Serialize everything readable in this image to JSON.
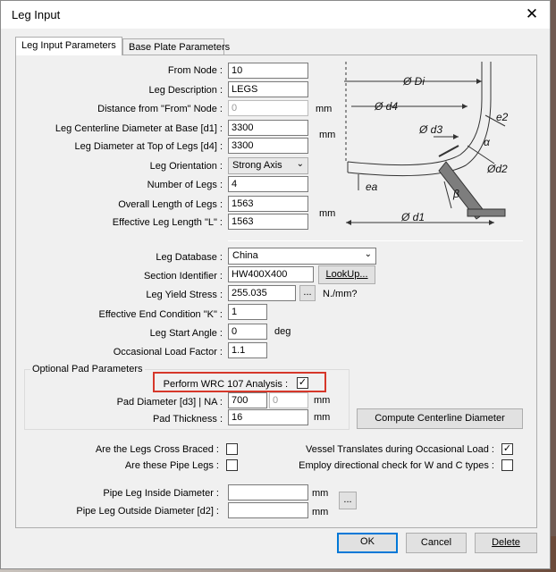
{
  "window": {
    "title": "Leg Input",
    "close_glyph": "✕"
  },
  "tabs": [
    "Leg Input Parameters",
    "Base Plate Parameters"
  ],
  "fields": {
    "from_node": {
      "label": "From Node :",
      "value": "10"
    },
    "leg_description": {
      "label": "Leg Description :",
      "value": "LEGS"
    },
    "distance_from": {
      "label": "Distance from \"From\" Node :",
      "value": "0",
      "unit": "mm"
    },
    "centerline_diameter": {
      "label": "Leg Centerline Diameter at Base [d1] :",
      "value": "3300"
    },
    "leg_diameter_top": {
      "label": "Leg Diameter at Top of Legs [d4] :",
      "value": "3300"
    },
    "diam_unit": "mm",
    "leg_orientation": {
      "label": "Leg Orientation :",
      "value": "Strong Axis"
    },
    "number_of_legs": {
      "label": "Number of Legs :",
      "value": "4"
    },
    "overall_length": {
      "label": "Overall Length of Legs :",
      "value": "1563"
    },
    "effective_length": {
      "label": "Effective Leg Length \"L\" :",
      "value": "1563"
    },
    "length_unit": "mm",
    "leg_database": {
      "label": "Leg Database :",
      "value": "China"
    },
    "section_identifier": {
      "label": "Section Identifier :",
      "value": "HW400X400"
    },
    "lookup_button": "LookUp...",
    "yield_stress": {
      "label": "Leg Yield Stress :",
      "value": "255.035",
      "unit": "N./mm?"
    },
    "end_condition": {
      "label": "Effective End Condition \"K\" :",
      "value": "1"
    },
    "start_angle": {
      "label": "Leg Start Angle :",
      "value": "0",
      "unit": "deg"
    },
    "load_factor": {
      "label": "Occasional Load Factor :",
      "value": "1.1"
    }
  },
  "pad": {
    "group_title": "Optional Pad Parameters",
    "wrc_label": "Perform WRC 107 Analysis :",
    "wrc_checked": true,
    "diameter_label": "Pad Diameter [d3] | NA :",
    "diameter_value": "700",
    "na_value": "0",
    "thickness_label": "Pad Thickness :",
    "thickness_value": "16",
    "unit": "mm",
    "compute_button": "Compute Centerline Diameter"
  },
  "checks": {
    "cross_braced": {
      "label": "Are the Legs Cross Braced :",
      "checked": false
    },
    "pipe_legs": {
      "label": "Are these Pipe Legs :",
      "checked": false
    },
    "vessel_translates": {
      "label": "Vessel Translates during Occasional Load :",
      "checked": true
    },
    "directional_check": {
      "label": "Employ directional check for W and C types :",
      "checked": false
    }
  },
  "pipe": {
    "inside_label": "Pipe Leg Inside Diameter :",
    "outside_label": "Pipe Leg Outside Diameter [d2] :",
    "unit": "mm",
    "ellipsis": "..."
  },
  "diagram_labels": {
    "di": "Ø Di",
    "d4": "Ø d4",
    "d3": "Ø d3",
    "e2": "e2",
    "alpha": "α",
    "d2": "Ød2",
    "ea": "ea",
    "beta": "β",
    "d1": "Ø d1"
  },
  "buttons": {
    "ok": "OK",
    "cancel": "Cancel",
    "delete": "Delete"
  },
  "glyphs": {
    "check": "✓",
    "combo_arrow": "⌄",
    "ellipsis": "..."
  },
  "colors": {
    "highlight": "#d6372a",
    "default_button_border": "#0078d7",
    "window_bg": "#f0f0f0"
  }
}
